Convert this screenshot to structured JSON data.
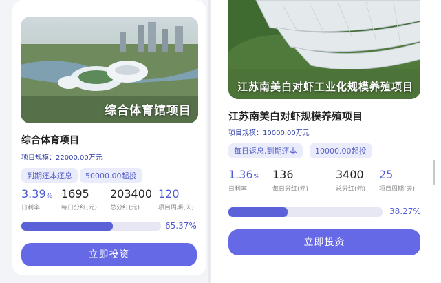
{
  "cards": [
    {
      "image_caption": "综合体育馆项目",
      "title": "综合体育项目",
      "scale": "项目规模：22000.00万元",
      "tags": [
        "到期还本还息",
        "50000.00起投"
      ],
      "stats": [
        {
          "value": "3.39",
          "unit": "%",
          "label": "日利率"
        },
        {
          "value": "1695",
          "label": "每日分红(元)"
        },
        {
          "value": "203400",
          "label": "总分红(元)"
        },
        {
          "value": "120",
          "label": "项目周期(天)"
        }
      ],
      "progress_percent": 65.37,
      "progress_label": "65.37%",
      "button_label": "立即投资"
    },
    {
      "image_caption": "江苏南美白对虾工业化规模养殖项目",
      "title": "江苏南美白对虾规模养殖项目",
      "scale": "项目规模：10000.00万元",
      "tags": [
        "每日返息,到期还本",
        "10000.00起投"
      ],
      "stats": [
        {
          "value": "1.36",
          "unit": "%",
          "label": "日利率"
        },
        {
          "value": "136",
          "label": "每日分红(元)"
        },
        {
          "value": "3400",
          "label": "总分红(元)"
        },
        {
          "value": "25",
          "label": "项目周期(天)"
        }
      ],
      "progress_percent": 38.27,
      "progress_label": "38.27%",
      "button_label": "立即投资"
    }
  ],
  "colors": {
    "accent": "#4f5bd5",
    "button": "#6569e6",
    "tag_bg": "#eaebfb"
  },
  "icons": [
    "stadium-photo",
    "greenhouse-photo"
  ]
}
